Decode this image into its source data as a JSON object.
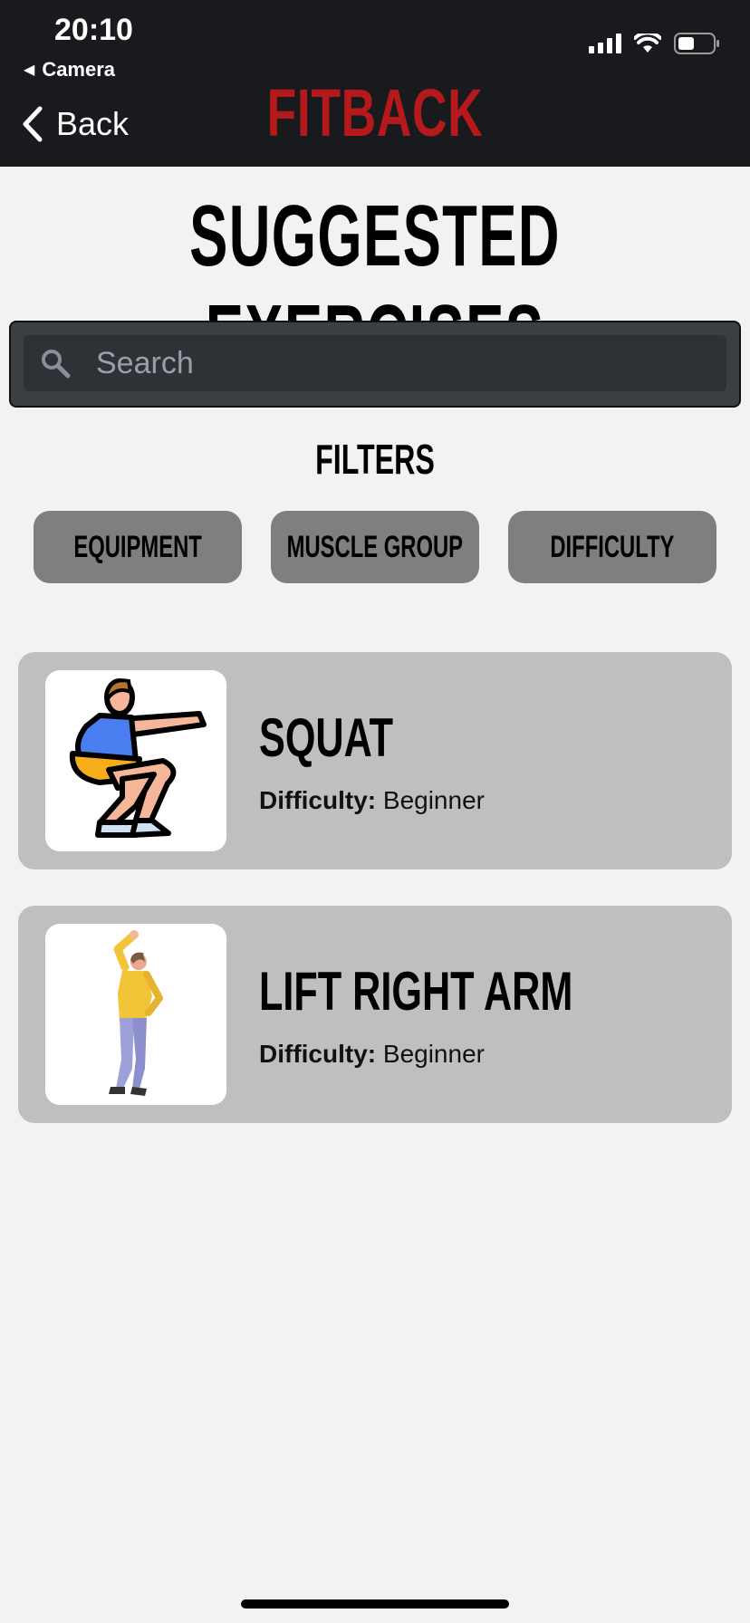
{
  "status_bar": {
    "time": "20:10",
    "back_app_label": "Camera"
  },
  "header": {
    "back_label": "Back",
    "brand": "FITBACK",
    "brand_color": "#b5191b"
  },
  "page_title": "SUGGESTED EXERCISES",
  "search": {
    "placeholder": "Search",
    "value": ""
  },
  "filters": {
    "title": "FILTERS",
    "buttons": [
      "EQUIPMENT",
      "MUSCLE GROUP",
      "DIFFICULTY"
    ]
  },
  "exercises": [
    {
      "name": "SQUAT",
      "difficulty_label": "Difficulty:",
      "difficulty": "Beginner",
      "image": "squat-illustration"
    },
    {
      "name": "LIFT RIGHT ARM",
      "difficulty_label": "Difficulty:",
      "difficulty": "Beginner",
      "image": "lift-arm-illustration"
    }
  ]
}
